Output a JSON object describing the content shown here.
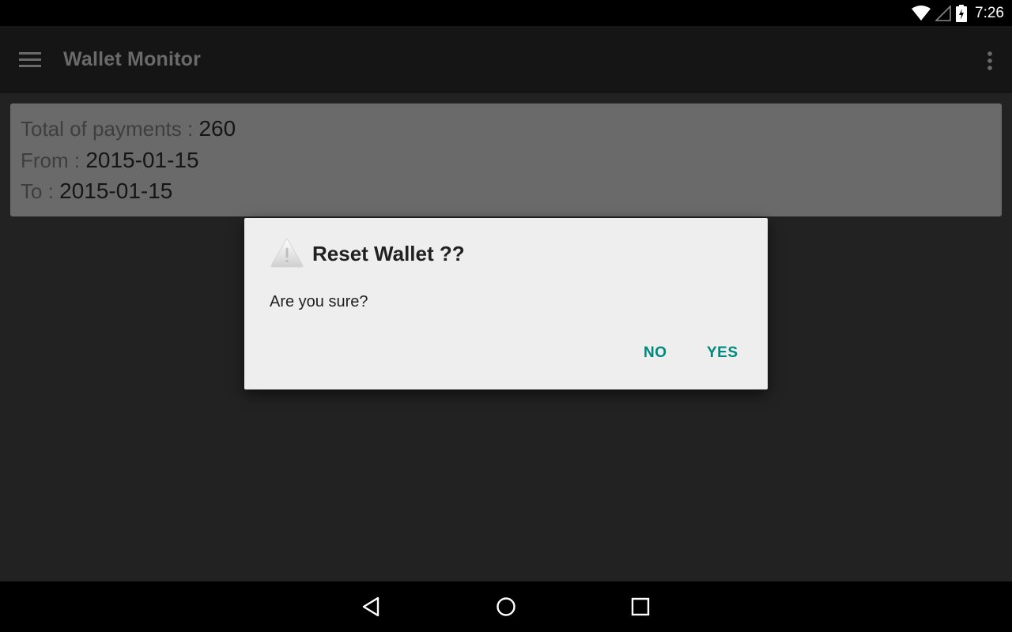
{
  "status_bar": {
    "time": "7:26",
    "icons": [
      "wifi-icon",
      "cell-signal-icon",
      "battery-charging-icon"
    ]
  },
  "toolbar": {
    "title": "Wallet Monitor",
    "icons": [
      "menu-icon",
      "overflow-menu-icon"
    ]
  },
  "summary": {
    "total_label": "Total of payments : ",
    "total_value": "260",
    "from_label": "From : ",
    "from_value": "2015-01-15",
    "to_label": "To : ",
    "to_value": "2015-01-15"
  },
  "dialog": {
    "icon": "warning-icon",
    "title": "Reset Wallet ??",
    "message": "Are you sure?",
    "no_label": "NO",
    "yes_label": "YES"
  },
  "nav_bar": {
    "icons": [
      "back-icon",
      "home-icon",
      "recents-icon"
    ]
  },
  "colors": {
    "accent": "#00897b",
    "background": "#222222",
    "toolbar": "#151515",
    "card": "#6a6a6a",
    "dialog": "#eeeeee"
  }
}
